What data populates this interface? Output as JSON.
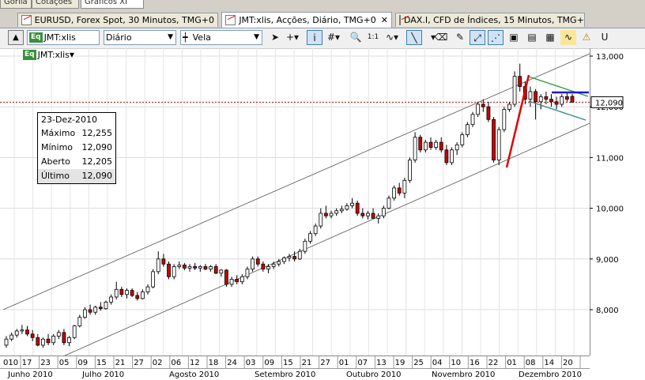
{
  "top_strip": [
    "Gorila",
    "Cotações",
    "Gráficos XI"
  ],
  "tabs": [
    {
      "label": "EURUSD, Forex Spot, 30 Minutos, TMG+0",
      "active": false
    },
    {
      "label": "JMT:xlis, Acções, Diário, TMG+0",
      "active": true,
      "close": "✕"
    },
    {
      "label": "DAX.I, CFD de Índices, 15 Minutos, TMG+0",
      "active": false
    }
  ],
  "toolbar": {
    "symbol_badge": "Eq",
    "symbol_value": "JMT:xlis",
    "period_value": "Diário",
    "chart_style_value": "Vela",
    "icons": [
      "cursor-icon",
      "crosshair-icon",
      "info-icon",
      "grid-icon",
      "zoom-icon",
      "one-to-one-icon",
      "indicator-icon",
      "line-tool-icon",
      "eraser-icon",
      "draw-icon",
      "trend-channel-icon",
      "fibonacci-icon",
      "fit-icon",
      "compare-icon",
      "template-icon",
      "wave-icon",
      "alert-icon",
      "magnet-icon"
    ],
    "one_to_one_label": "1:1"
  },
  "chart_header": {
    "badge": "Eq",
    "symbol": "JMT:xlis"
  },
  "info_box": {
    "date": "23-Dez-2010",
    "rows": [
      {
        "label": "Máximo",
        "value": "12,255"
      },
      {
        "label": "Mínimo",
        "value": "12,090"
      },
      {
        "label": "Aberto",
        "value": "12,205"
      },
      {
        "label": "Último",
        "value": "12,090"
      }
    ]
  },
  "colors": {
    "up": "#ffffff",
    "down": "#cc0000",
    "wick": "#000000",
    "channel": "#555555",
    "red_line": "#e00000",
    "green_line": "#2e9b2e",
    "teal_line": "#2a8a8a",
    "blue_line": "#1a1ad0",
    "current_price": "#c00000"
  },
  "chart_data": {
    "type": "candlestick",
    "y_ticks": [
      "13,000",
      "12,000",
      "11,000",
      "10,000",
      "9,000",
      "8,000"
    ],
    "y_tick_values": [
      13000,
      12000,
      11000,
      10000,
      9000,
      8000
    ],
    "ylim": [
      7000,
      13100
    ],
    "current_price_label": "12,090",
    "current_price": 12090,
    "day_labels": [
      "010",
      "17",
      "23",
      "05",
      "09",
      "15",
      "21",
      "27",
      "02",
      "06",
      "12",
      "18",
      "24",
      "03",
      "09",
      "15",
      "21",
      "27",
      "01",
      "07",
      "13",
      "19",
      "25",
      "04",
      "10",
      "16",
      "22",
      "01",
      "08",
      "14",
      "20"
    ],
    "month_labels": [
      "Junho 2010",
      "Julho 2010",
      "Agosto 2010",
      "Setembro 2010",
      "Outubro 2010",
      "Novembro 2010",
      "Dezembro 2010"
    ],
    "candles": [
      [
        7300,
        7480,
        7250,
        7420
      ],
      [
        7420,
        7550,
        7380,
        7500
      ],
      [
        7500,
        7620,
        7450,
        7580
      ],
      [
        7580,
        7700,
        7520,
        7600
      ],
      [
        7600,
        7680,
        7480,
        7520
      ],
      [
        7520,
        7600,
        7380,
        7450
      ],
      [
        7450,
        7520,
        7280,
        7300
      ],
      [
        7300,
        7450,
        7250,
        7420
      ],
      [
        7420,
        7520,
        7300,
        7350
      ],
      [
        7350,
        7520,
        7300,
        7480
      ],
      [
        7480,
        7600,
        7420,
        7550
      ],
      [
        7550,
        7620,
        7300,
        7350
      ],
      [
        7350,
        7480,
        7280,
        7450
      ],
      [
        7450,
        7700,
        7420,
        7680
      ],
      [
        7680,
        7900,
        7650,
        7850
      ],
      [
        7850,
        8050,
        7820,
        8000
      ],
      [
        8000,
        8100,
        7900,
        7950
      ],
      [
        7950,
        8080,
        7900,
        8050
      ],
      [
        8050,
        8150,
        7980,
        8020
      ],
      [
        8020,
        8180,
        8000,
        8150
      ],
      [
        8150,
        8300,
        8100,
        8250
      ],
      [
        8250,
        8550,
        8200,
        8400
      ],
      [
        8400,
        8450,
        8250,
        8300
      ],
      [
        8300,
        8420,
        8220,
        8380
      ],
      [
        8380,
        8420,
        8250,
        8280
      ],
      [
        8280,
        8350,
        8180,
        8220
      ],
      [
        8220,
        8400,
        8200,
        8350
      ],
      [
        8350,
        8500,
        8300,
        8450
      ],
      [
        8450,
        8800,
        8420,
        8750
      ],
      [
        8750,
        9150,
        8700,
        9000
      ],
      [
        9000,
        9100,
        8850,
        8900
      ],
      [
        8900,
        8950,
        8600,
        8650
      ],
      [
        8650,
        8900,
        8600,
        8850
      ],
      [
        8850,
        8950,
        8800,
        8880
      ],
      [
        8880,
        8920,
        8780,
        8820
      ],
      [
        8820,
        8900,
        8750,
        8850
      ],
      [
        8850,
        8920,
        8780,
        8820
      ],
      [
        8820,
        8880,
        8750,
        8850
      ],
      [
        8850,
        8900,
        8780,
        8800
      ],
      [
        8800,
        8880,
        8750,
        8850
      ],
      [
        8850,
        8900,
        8700,
        8720
      ],
      [
        8720,
        8800,
        8650,
        8780
      ],
      [
        8780,
        8800,
        8450,
        8500
      ],
      [
        8500,
        8650,
        8450,
        8600
      ],
      [
        8600,
        8680,
        8500,
        8550
      ],
      [
        8550,
        8700,
        8500,
        8650
      ],
      [
        8650,
        8850,
        8600,
        8800
      ],
      [
        8800,
        9050,
        8750,
        9000
      ],
      [
        9000,
        9050,
        8850,
        8900
      ],
      [
        8900,
        8950,
        8750,
        8800
      ],
      [
        8800,
        8900,
        8720,
        8850
      ],
      [
        8850,
        8950,
        8800,
        8900
      ],
      [
        8900,
        9000,
        8850,
        8950
      ],
      [
        8950,
        9050,
        8900,
        9020
      ],
      [
        9020,
        9100,
        8950,
        9050
      ],
      [
        9050,
        9150,
        8950,
        9000
      ],
      [
        9000,
        9200,
        8980,
        9150
      ],
      [
        9150,
        9400,
        9100,
        9350
      ],
      [
        9350,
        9550,
        9300,
        9500
      ],
      [
        9500,
        9700,
        9450,
        9650
      ],
      [
        9650,
        10000,
        9600,
        9900
      ],
      [
        9900,
        10050,
        9800,
        9850
      ],
      [
        9850,
        9950,
        9800,
        9900
      ],
      [
        9900,
        10000,
        9850,
        9950
      ],
      [
        9950,
        10050,
        9900,
        9980
      ],
      [
        9980,
        10100,
        9950,
        10050
      ],
      [
        10050,
        10200,
        10000,
        10100
      ],
      [
        10100,
        10150,
        9850,
        9900
      ],
      [
        9900,
        10000,
        9800,
        9850
      ],
      [
        9850,
        9950,
        9780,
        9900
      ],
      [
        9900,
        10000,
        9850,
        9800
      ],
      [
        9800,
        9900,
        9700,
        9850
      ],
      [
        9850,
        10050,
        9800,
        10000
      ],
      [
        10000,
        10250,
        9980,
        10200
      ],
      [
        10200,
        10450,
        10150,
        10400
      ],
      [
        10400,
        10500,
        10250,
        10300
      ],
      [
        10300,
        10600,
        10200,
        10550
      ],
      [
        10550,
        11000,
        10500,
        10950
      ],
      [
        10950,
        11500,
        10900,
        11400
      ],
      [
        11400,
        11450,
        11100,
        11150
      ],
      [
        11150,
        11350,
        11100,
        11300
      ],
      [
        11300,
        11400,
        11150,
        11200
      ],
      [
        11200,
        11350,
        11150,
        11300
      ],
      [
        11300,
        11400,
        11100,
        11150
      ],
      [
        11150,
        11250,
        10850,
        10900
      ],
      [
        10900,
        11200,
        10850,
        11150
      ],
      [
        11150,
        11300,
        11050,
        11250
      ],
      [
        11250,
        11500,
        11200,
        11450
      ],
      [
        11450,
        11700,
        11400,
        11650
      ],
      [
        11650,
        11900,
        11600,
        11850
      ],
      [
        11850,
        12100,
        11800,
        12050
      ],
      [
        12050,
        12150,
        11900,
        12000
      ],
      [
        12000,
        12100,
        11700,
        11750
      ],
      [
        11750,
        11800,
        10900,
        10950
      ],
      [
        10950,
        11600,
        10850,
        11550
      ],
      [
        11550,
        12000,
        11500,
        11950
      ],
      [
        11950,
        12100,
        11900,
        12050
      ],
      [
        12050,
        12700,
        12000,
        12600
      ],
      [
        12600,
        12850,
        12300,
        12400
      ],
      [
        12400,
        12500,
        12050,
        12150
      ],
      [
        12150,
        12400,
        12000,
        12300
      ],
      [
        12300,
        12350,
        11750,
        12100
      ],
      [
        12100,
        12250,
        11950,
        12200
      ],
      [
        12200,
        12300,
        12050,
        12150
      ],
      [
        12150,
        12250,
        12000,
        12100
      ],
      [
        12100,
        12200,
        11950,
        12050
      ],
      [
        12050,
        12250,
        12000,
        12200
      ],
      [
        12200,
        12300,
        12100,
        12150
      ],
      [
        12205,
        12255,
        12090,
        12090
      ]
    ]
  }
}
